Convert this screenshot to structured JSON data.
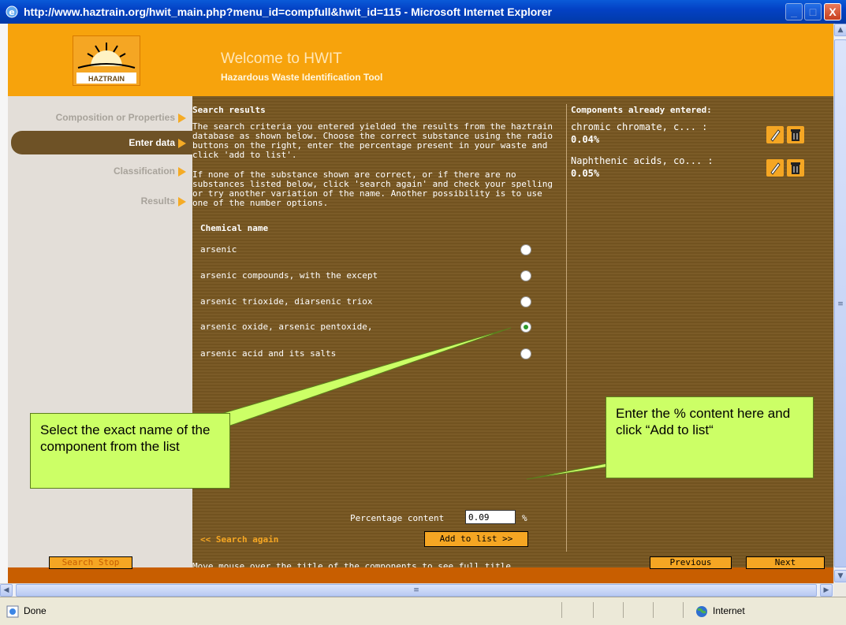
{
  "window": {
    "title": "http://www.haztrain.org/hwit_main.php?menu_id=compfull&hwit_id=115 - Microsoft Internet Explorer",
    "minimize": "_",
    "maximize": "□",
    "close": "X"
  },
  "header": {
    "logo_text": "HAZTRAIN",
    "welcome": "Welcome to HWIT",
    "subtitle": "Hazardous Waste Identification Tool"
  },
  "nav": {
    "items": [
      {
        "label": "Composition or Properties"
      },
      {
        "label": "Enter data"
      },
      {
        "label": "Classification"
      },
      {
        "label": "Results"
      }
    ]
  },
  "search": {
    "title": "Search results",
    "para1": "The search criteria you entered yielded the results from the haztrain database as shown below. Choose the correct substance using the radio buttons on the right, enter the percentage present in your waste and click 'add to list'.",
    "para2": "If none of the substance shown are correct, or if there are no substances listed below, click 'search again' and check your spelling or try another variation of the name. Another possibility is to use one of the number options.",
    "column_header": "Chemical name",
    "results": [
      {
        "name": "arsenic",
        "selected": false
      },
      {
        "name": "arsenic compounds, with the except",
        "selected": false
      },
      {
        "name": "arsenic trioxide, diarsenic triox",
        "selected": false
      },
      {
        "name": "arsenic oxide, arsenic pentoxide,",
        "selected": true
      },
      {
        "name": "arsenic acid and its salts",
        "selected": false
      }
    ],
    "percentage_label": "Percentage content",
    "percentage_value": "0.09",
    "percentage_unit": "%",
    "search_again": "<< Search again",
    "add_to_list": "Add to list >>",
    "footnote": "Move mouse over the title of the components to see full title"
  },
  "components": {
    "title": "Components already entered:",
    "items": [
      {
        "name": "chromic chromate, c... :",
        "pct": "0.04%"
      },
      {
        "name": "Naphthenic acids, co... :",
        "pct": "0.05%"
      }
    ]
  },
  "callouts": {
    "left": "Select the exact name of the component from the list",
    "right": "Enter the % content here and click “Add to list“"
  },
  "bottom_nav": {
    "left_button": "Search Stop",
    "previous": "Previous",
    "next": "Next"
  },
  "statusbar": {
    "status": "Done",
    "zone": "Internet"
  },
  "colors": {
    "header_orange": "#f7a30c",
    "content_brown": "#7b5b27",
    "button_orange": "#f5a623",
    "callout_green": "#ccff66",
    "titlebar_blue": "#0341c4"
  }
}
